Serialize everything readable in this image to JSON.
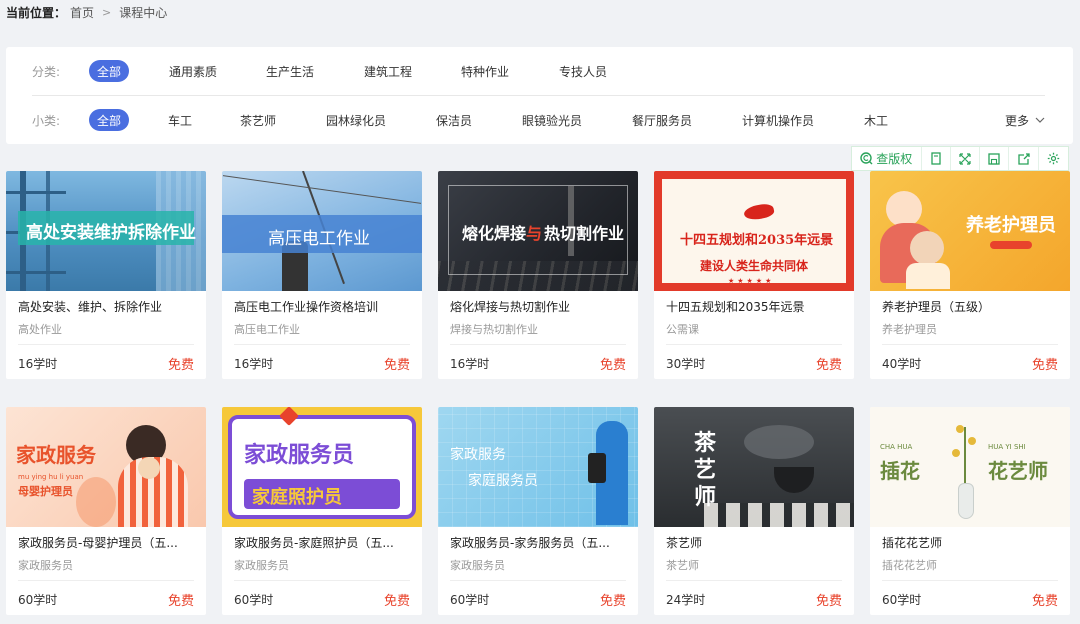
{
  "breadcrumb": {
    "label": "当前位置：",
    "items": [
      "首页",
      "课程中心"
    ]
  },
  "filters": {
    "category": {
      "label": "分类:",
      "items": [
        "全部",
        "通用素质",
        "生产生活",
        "建筑工程",
        "特种作业",
        "专技人员"
      ],
      "active": 0
    },
    "subcategory": {
      "label": "小类:",
      "items": [
        "全部",
        "车工",
        "茶艺师",
        "园林绿化员",
        "保洁员",
        "眼镜验光员",
        "餐厅服务员",
        "计算机操作员",
        "木工"
      ],
      "active": 0,
      "more_label": "更多"
    }
  },
  "toolbar": {
    "copyright_label": "查版权"
  },
  "cover_texts": {
    "c1": "高处安装维护拆除作业",
    "c2": "高压电工作业",
    "c3a": "熔化焊接",
    "c3b": "与",
    "c3c": "热切割作业",
    "c4a": "十四五规划和2035年远景",
    "c4b": "建设人类生命共同体",
    "c5a": "养老护理员",
    "c6a": "家政服务",
    "c6b": "mu ying hu li yuan",
    "c6c": "母婴护理员",
    "c7a": "家政服务员",
    "c7b": "家庭照护员",
    "c8a": "家政服务",
    "c8b": "家庭服务员",
    "c9a": "茶",
    "c9b": "艺",
    "c9c": "师",
    "c10a": "CHA  HUA",
    "c10b": "插花",
    "c10c": "HUA  YI  SHI",
    "c10d": "花艺师"
  },
  "courses": [
    {
      "title": "高处安装、维护、拆除作业",
      "subtitle": "高处作业",
      "hours": "16学时",
      "price": "免费"
    },
    {
      "title": "高压电工作业操作资格培训",
      "subtitle": "高压电工作业",
      "hours": "16学时",
      "price": "免费"
    },
    {
      "title": "熔化焊接与热切割作业",
      "subtitle": "焊接与热切割作业",
      "hours": "16学时",
      "price": "免费"
    },
    {
      "title": "十四五规划和2035年远景",
      "subtitle": "公需课",
      "hours": "30学时",
      "price": "免费"
    },
    {
      "title": "养老护理员（五级）",
      "subtitle": "养老护理员",
      "hours": "40学时",
      "price": "免费"
    },
    {
      "title": "家政服务员-母婴护理员（五...",
      "subtitle": "家政服务员",
      "hours": "60学时",
      "price": "免费"
    },
    {
      "title": "家政服务员-家庭照护员（五...",
      "subtitle": "家政服务员",
      "hours": "60学时",
      "price": "免费"
    },
    {
      "title": "家政服务员-家务服务员（五...",
      "subtitle": "家政服务员",
      "hours": "60学时",
      "price": "免费"
    },
    {
      "title": "茶艺师",
      "subtitle": "茶艺师",
      "hours": "24学时",
      "price": "免费"
    },
    {
      "title": "插花花艺师",
      "subtitle": "插花花艺师",
      "hours": "60学时",
      "price": "免费"
    }
  ],
  "colors": {
    "accent": "#4a6ee0",
    "free": "#e8432c",
    "toolbar": "#2aa35a"
  },
  "icons": [
    "chevron-right-icon",
    "chevron-down-icon",
    "copyright-search-icon",
    "book-icon",
    "fullscreen-icon",
    "save-icon",
    "share-icon",
    "gear-icon"
  ]
}
